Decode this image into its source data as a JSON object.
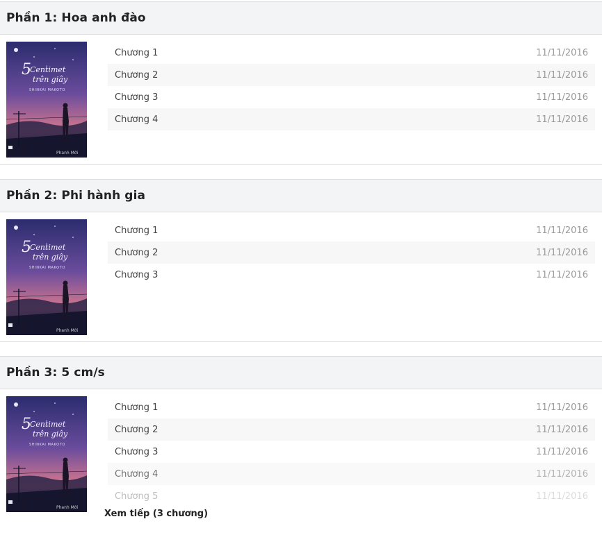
{
  "volumes": [
    {
      "title": "Phần 1: Hoa anh đào",
      "chapters": [
        {
          "name": "Chương 1",
          "date": "11/11/2016"
        },
        {
          "name": "Chương 2",
          "date": "11/11/2016"
        },
        {
          "name": "Chương 3",
          "date": "11/11/2016"
        },
        {
          "name": "Chương 4",
          "date": "11/11/2016"
        }
      ]
    },
    {
      "title": "Phần 2: Phi hành gia",
      "chapters": [
        {
          "name": "Chương 1",
          "date": "11/11/2016"
        },
        {
          "name": "Chương 2",
          "date": "11/11/2016"
        },
        {
          "name": "Chương 3",
          "date": "11/11/2016"
        }
      ]
    },
    {
      "title": "Phần 3: 5 cm/s",
      "chapters": [
        {
          "name": "Chương 1",
          "date": "11/11/2016"
        },
        {
          "name": "Chương 2",
          "date": "11/11/2016"
        },
        {
          "name": "Chương 3",
          "date": "11/11/2016"
        },
        {
          "name": "Chương 4",
          "date": "11/11/2016"
        },
        {
          "name": "Chương 5",
          "date": "11/11/2016"
        }
      ],
      "more_label": "Xem tiếp (3 chương)"
    }
  ],
  "cover": {
    "title_line1": "5 Centimet",
    "title_line2": "trên giây",
    "author": "SHINKAI MAKOTO",
    "publisher": "Phanh Mới",
    "colors": {
      "sky_top": "#2b2c6e",
      "sky_mid": "#6a4c9c",
      "horizon": "#d97a8c",
      "ground": "#1a1c3a"
    }
  }
}
